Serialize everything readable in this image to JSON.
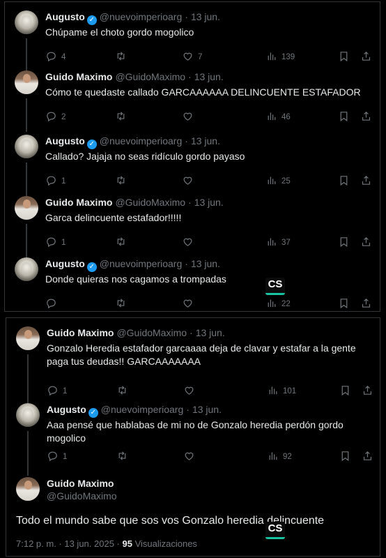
{
  "panel1": {
    "tweets": [
      {
        "name": "Augusto",
        "verified": true,
        "handle": "@nuevoimperioarg",
        "date": "13 jun.",
        "text": "Chúpame el choto gordo mogolico",
        "replies": "4",
        "retweets": "",
        "likes": "7",
        "views": "139",
        "avatar": "statue"
      },
      {
        "name": "Guido Maximo",
        "verified": false,
        "handle": "@GuidoMaximo",
        "date": "13 jun.",
        "text": "Cómo te quedaste callado GARCAAAAAA DELINCUENTE ESTAFADOR",
        "replies": "2",
        "retweets": "",
        "likes": "",
        "views": "46",
        "avatar": "guido"
      },
      {
        "name": "Augusto",
        "verified": true,
        "handle": "@nuevoimperioarg",
        "date": "13 jun.",
        "text": "Callado? Jajaja no seas ridículo gordo payaso",
        "replies": "1",
        "retweets": "",
        "likes": "",
        "views": "25",
        "avatar": "statue"
      },
      {
        "name": "Guido Maximo",
        "verified": false,
        "handle": "@GuidoMaximo",
        "date": "13 jun.",
        "text": "Garca delincuente estafador!!!!!",
        "replies": "1",
        "retweets": "",
        "likes": "",
        "views": "37",
        "avatar": "guido"
      },
      {
        "name": "Augusto",
        "verified": true,
        "handle": "@nuevoimperioarg",
        "date": "13 jun.",
        "text": "Donde quieras nos cagamos a trompadas",
        "replies": "",
        "retweets": "",
        "likes": "",
        "views": "22",
        "avatar": "statue"
      }
    ]
  },
  "panel2": {
    "tweets": [
      {
        "name": "Guido Maximo",
        "verified": false,
        "handle": "@GuidoMaximo",
        "date": "13 jun.",
        "text": "Gonzalo Heredia estafador garcaaaa deja de clavar y estafar a la gente paga tus deudas!! GARCAAAAAAA",
        "replies": "1",
        "retweets": "",
        "likes": "",
        "views": "101",
        "avatar": "guido"
      },
      {
        "name": "Augusto",
        "verified": true,
        "handle": "@nuevoimperioarg",
        "date": "13 jun.",
        "text": "Aaa pensé que hablabas de mi no de Gonzalo heredia perdón gordo mogolico",
        "replies": "1",
        "retweets": "",
        "likes": "",
        "views": "92",
        "avatar": "statue"
      }
    ],
    "focus": {
      "name": "Guido Maximo",
      "handle": "@GuidoMaximo",
      "text": "Todo el mundo sabe que sos vos Gonzalo heredia delincuente",
      "time": "7:12 p. m. · 13 jun. 2025 · ",
      "views_count": "95",
      "views_label": " Visualizaciones"
    }
  },
  "separator": "·",
  "verified_mark": "✓",
  "watermark": "CS",
  "colors": {
    "background": "#000000",
    "text": "#e7e9ea",
    "muted": "#71767b",
    "verified": "#1d9bf0",
    "watermark_accent": "#17c3a1"
  }
}
